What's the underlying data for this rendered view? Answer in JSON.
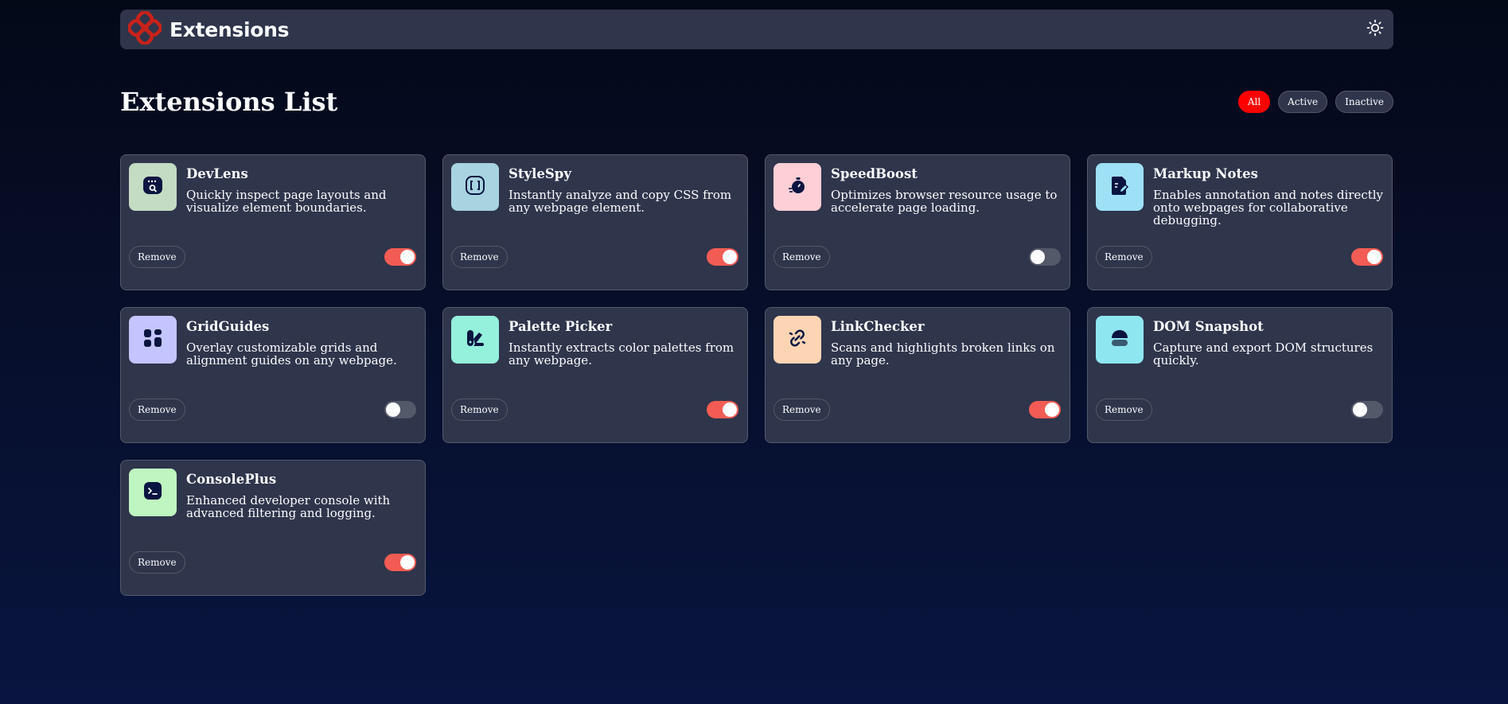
{
  "app": {
    "title": "Extensions"
  },
  "page": {
    "title": "Extensions List"
  },
  "filters": [
    {
      "label": "All",
      "active": true
    },
    {
      "label": "Active",
      "active": false
    },
    {
      "label": "Inactive",
      "active": false
    }
  ],
  "extensions": [
    {
      "name": "DevLens",
      "description": "Quickly inspect page layouts and visualize element boundaries.",
      "icon": "window-search-icon",
      "icon_bg": "#c3dcc3",
      "enabled": true,
      "remove_label": "Remove"
    },
    {
      "name": "StyleSpy",
      "description": "Instantly analyze and copy CSS from any webpage element.",
      "icon": "brackets-icon",
      "icon_bg": "#a8d3e0",
      "enabled": true,
      "remove_label": "Remove"
    },
    {
      "name": "SpeedBoost",
      "description": "Optimizes browser resource usage to accelerate page loading.",
      "icon": "stopwatch-icon",
      "icon_bg": "#fecfd6",
      "enabled": false,
      "remove_label": "Remove"
    },
    {
      "name": "Markup Notes",
      "description": "Enables annotation and notes directly onto webpages for collaborative debugging.",
      "icon": "note-pen-icon",
      "icon_bg": "#9ee0f5",
      "enabled": true,
      "remove_label": "Remove"
    },
    {
      "name": "GridGuides",
      "description": "Overlay customizable grids and alignment guides on any webpage.",
      "icon": "grid-icon",
      "icon_bg": "#c4c4ff",
      "enabled": false,
      "remove_label": "Remove"
    },
    {
      "name": "Palette Picker",
      "description": "Instantly extracts color palettes from any webpage.",
      "icon": "palette-icon",
      "icon_bg": "#95f0dc",
      "enabled": true,
      "remove_label": "Remove"
    },
    {
      "name": "LinkChecker",
      "description": "Scans and highlights broken links on any page.",
      "icon": "broken-link-icon",
      "icon_bg": "#fdd5b4",
      "enabled": true,
      "remove_label": "Remove"
    },
    {
      "name": "DOM Snapshot",
      "description": "Capture and export DOM structures quickly.",
      "icon": "snapshot-icon",
      "icon_bg": "#8ee6f0",
      "enabled": false,
      "remove_label": "Remove"
    },
    {
      "name": "ConsolePlus",
      "description": "Enhanced developer console with advanced filtering and logging.",
      "icon": "terminal-icon",
      "icon_bg": "#bff5c0",
      "enabled": true,
      "remove_label": "Remove"
    }
  ],
  "colors": {
    "accent": "#f25c54",
    "filter_active": "#ff0000",
    "card_bg": "#2f354b",
    "brand": "#c7221a"
  }
}
